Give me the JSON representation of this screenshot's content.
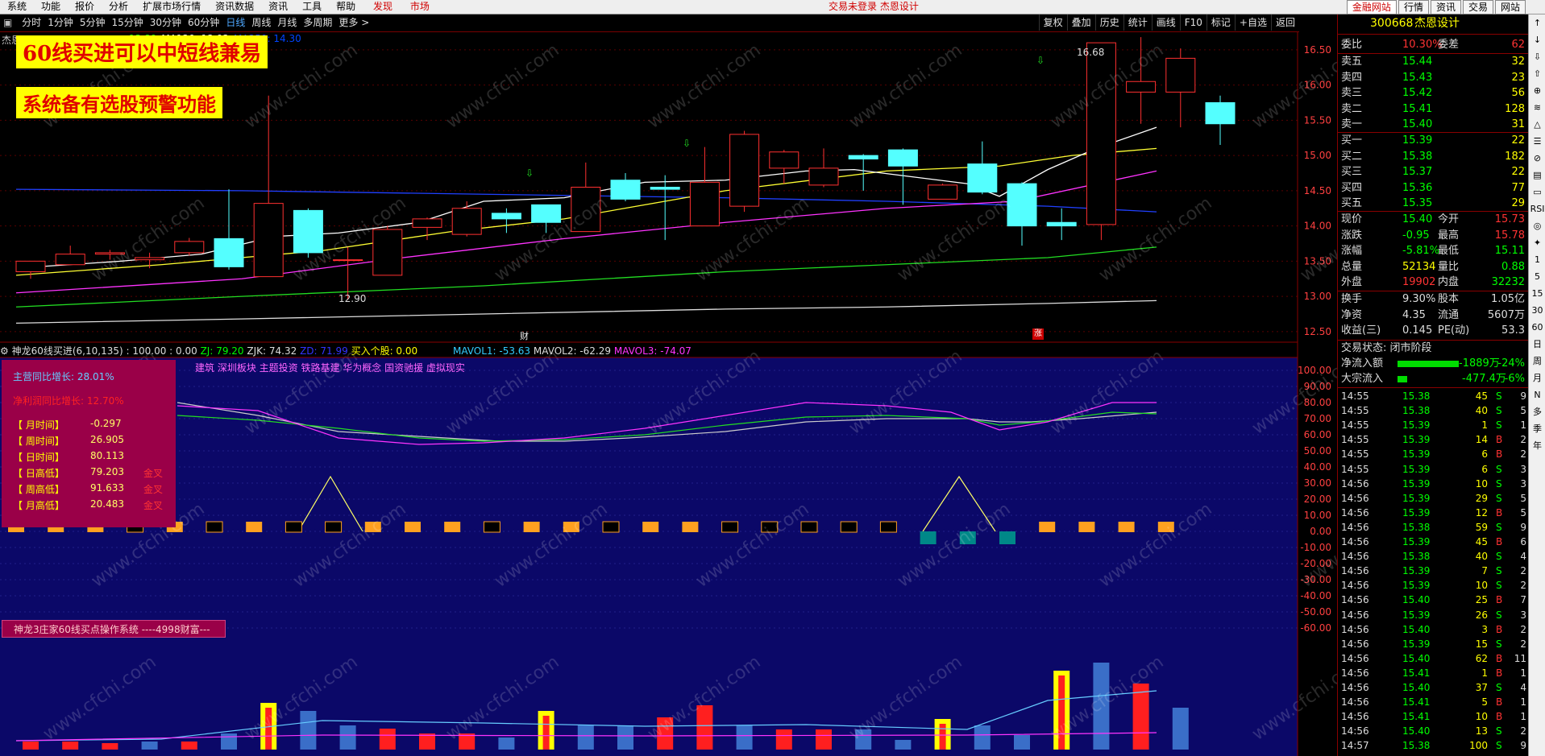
{
  "menu": {
    "items": [
      "系统",
      "功能",
      "报价",
      "分析",
      "扩展市场行情",
      "资讯数据",
      "资讯",
      "工具",
      "帮助"
    ],
    "discover": "发现",
    "market": "市场",
    "center_title": "交易未登录  杰恩设计",
    "right_tabs": [
      "金融网站",
      "行情",
      "资讯",
      "交易",
      "网站"
    ]
  },
  "periods": [
    "分时",
    "1分钟",
    "5分钟",
    "15分钟",
    "30分钟",
    "60分钟",
    "日线",
    "周线",
    "月线",
    "多周期",
    "更多 >"
  ],
  "active_period": "日线",
  "tools": [
    "复权",
    "叠加",
    "历史",
    "统计",
    "画线",
    "F10",
    "标记",
    "+自选",
    "返回"
  ],
  "main_chart": {
    "stock_label": "杰恩",
    "ma_legend": [
      {
        "text": "13.89",
        "color": "#00ff00"
      },
      {
        "text": "MA120: 12.92",
        "color": "#ffffff"
      },
      {
        "text": "MA250: 14.30",
        "color": "#0044ff"
      }
    ],
    "high_label": "16.68",
    "low_label": "12.90",
    "markers": [
      "财",
      "涨"
    ],
    "overlay1": "60线买进可以中短线兼易",
    "overlay2": "系统备有选股预警功能",
    "axis": [
      "16.50",
      "16.00",
      "15.50",
      "15.00",
      "14.50",
      "14.00",
      "13.50",
      "13.00",
      "12.50"
    ]
  },
  "indicator": {
    "title": "神龙60线买进(6,10,135)",
    "values": ": 100.00 : 0.00",
    "zj": "ZJ: 79.20",
    "zjk": "ZJK: 74.32",
    "zd": "ZD: 71.99",
    "buy": "买入个股: 0.00",
    "mavol1": "MAVOL1: -53.63",
    "mavol2": "MAVOL2: -62.29",
    "mavol3": "MAVOL3: -74.07",
    "concepts": "建筑 深圳板块 主题投资 铁路基建 华为概念 国资驰援 虚拟现实",
    "panel": {
      "line1": "主营同比增长: 28.01%",
      "line2": "净利润同比增长: 12.70%",
      "rows": [
        {
          "label": "【 月时间】",
          "value": "-0.297",
          "tag": ""
        },
        {
          "label": "【 周时间】",
          "value": "26.905",
          "tag": ""
        },
        {
          "label": "【 日时间】",
          "value": "80.113",
          "tag": ""
        },
        {
          "label": "【 日高低】",
          "value": "79.203",
          "tag": "金叉"
        },
        {
          "label": "【 周高低】",
          "value": "91.633",
          "tag": "金叉"
        },
        {
          "label": "【 月高低】",
          "value": "20.483",
          "tag": "金叉"
        }
      ]
    },
    "system_label": "神龙3庄家60线买点操作系统 ----4998财富---",
    "axis": [
      "100.00",
      "90.00",
      "80.00",
      "70.00",
      "60.00",
      "50.00",
      "40.00",
      "30.00",
      "20.00",
      "10.00",
      "0.00",
      "-10.00",
      "-20.00",
      "-30.00",
      "-40.00",
      "-50.00",
      "-60.00"
    ]
  },
  "quote": {
    "code": "300668",
    "name": "杰恩设计",
    "weibi_label": "委比",
    "weibi_value": "10.30%",
    "weicha_label": "委差",
    "weicha_value": "62",
    "sells": [
      {
        "label": "卖五",
        "price": "15.44",
        "vol": "32"
      },
      {
        "label": "卖四",
        "price": "15.43",
        "vol": "23"
      },
      {
        "label": "卖三",
        "price": "15.42",
        "vol": "56"
      },
      {
        "label": "卖二",
        "price": "15.41",
        "vol": "128"
      },
      {
        "label": "卖一",
        "price": "15.40",
        "vol": "31"
      }
    ],
    "buys": [
      {
        "label": "买一",
        "price": "15.39",
        "vol": "22"
      },
      {
        "label": "买二",
        "price": "15.38",
        "vol": "182"
      },
      {
        "label": "买三",
        "price": "15.37",
        "vol": "22"
      },
      {
        "label": "买四",
        "price": "15.36",
        "vol": "77"
      },
      {
        "label": "买五",
        "price": "15.35",
        "vol": "29"
      }
    ],
    "stats": [
      {
        "l1": "现价",
        "v1": "15.40",
        "c1": "#00ff00",
        "l2": "今开",
        "v2": "15.73",
        "c2": "#ff3333"
      },
      {
        "l1": "涨跌",
        "v1": "-0.95",
        "c1": "#00ff00",
        "l2": "最高",
        "v2": "15.78",
        "c2": "#ff3333"
      },
      {
        "l1": "涨幅",
        "v1": "-5.81%",
        "c1": "#00ff00",
        "l2": "最低",
        "v2": "15.11",
        "c2": "#00ff00"
      },
      {
        "l1": "总量",
        "v1": "52134",
        "c1": "#ffff00",
        "l2": "量比",
        "v2": "0.88",
        "c2": "#00ff00"
      },
      {
        "l1": "外盘",
        "v1": "19902",
        "c1": "#ff3333",
        "l2": "内盘",
        "v2": "32232",
        "c2": "#00ff00"
      }
    ],
    "stats2": [
      {
        "l1": "换手",
        "v1": "9.30%",
        "l2": "股本",
        "v2": "1.05亿"
      },
      {
        "l1": "净资",
        "v1": "4.35",
        "l2": "流通",
        "v2": "5607万"
      },
      {
        "l1": "收益(三)",
        "v1": "0.145",
        "l2": "PE(动)",
        "v2": "53.3"
      }
    ],
    "trade_status": "交易状态: 闭市阶段",
    "net_inflow_label": "净流入额",
    "net_inflow_value": "-1889万",
    "net_inflow_pct": "-24%",
    "big_inflow_label": "大宗流入",
    "big_inflow_value": "-477.4万",
    "big_inflow_pct": "-6%",
    "ticks": [
      {
        "t": "14:55",
        "p": "15.38",
        "v": "45",
        "d": "S",
        "n": "9"
      },
      {
        "t": "14:55",
        "p": "15.38",
        "v": "40",
        "d": "S",
        "n": "5"
      },
      {
        "t": "14:55",
        "p": "15.39",
        "v": "1",
        "d": "S",
        "n": "1"
      },
      {
        "t": "14:55",
        "p": "15.39",
        "v": "14",
        "d": "B",
        "n": "2"
      },
      {
        "t": "14:55",
        "p": "15.39",
        "v": "6",
        "d": "B",
        "n": "2"
      },
      {
        "t": "14:55",
        "p": "15.39",
        "v": "6",
        "d": "S",
        "n": "3"
      },
      {
        "t": "14:56",
        "p": "15.39",
        "v": "10",
        "d": "S",
        "n": "3"
      },
      {
        "t": "14:56",
        "p": "15.39",
        "v": "29",
        "d": "S",
        "n": "5"
      },
      {
        "t": "14:56",
        "p": "15.39",
        "v": "12",
        "d": "B",
        "n": "5"
      },
      {
        "t": "14:56",
        "p": "15.38",
        "v": "59",
        "d": "S",
        "n": "9"
      },
      {
        "t": "14:56",
        "p": "15.39",
        "v": "45",
        "d": "B",
        "n": "6"
      },
      {
        "t": "14:56",
        "p": "15.38",
        "v": "40",
        "d": "S",
        "n": "4"
      },
      {
        "t": "14:56",
        "p": "15.39",
        "v": "7",
        "d": "S",
        "n": "2"
      },
      {
        "t": "14:56",
        "p": "15.39",
        "v": "10",
        "d": "S",
        "n": "2"
      },
      {
        "t": "14:56",
        "p": "15.40",
        "v": "25",
        "d": "B",
        "n": "7"
      },
      {
        "t": "14:56",
        "p": "15.39",
        "v": "26",
        "d": "S",
        "n": "3"
      },
      {
        "t": "14:56",
        "p": "15.40",
        "v": "3",
        "d": "B",
        "n": "2"
      },
      {
        "t": "14:56",
        "p": "15.39",
        "v": "15",
        "d": "S",
        "n": "2"
      },
      {
        "t": "14:56",
        "p": "15.40",
        "v": "62",
        "d": "B",
        "n": "11"
      },
      {
        "t": "14:56",
        "p": "15.41",
        "v": "1",
        "d": "B",
        "n": "1"
      },
      {
        "t": "14:56",
        "p": "15.40",
        "v": "37",
        "d": "S",
        "n": "4"
      },
      {
        "t": "14:56",
        "p": "15.41",
        "v": "5",
        "d": "B",
        "n": "1"
      },
      {
        "t": "14:56",
        "p": "15.41",
        "v": "10",
        "d": "B",
        "n": "1"
      },
      {
        "t": "14:56",
        "p": "15.40",
        "v": "13",
        "d": "S",
        "n": "2"
      },
      {
        "t": "14:57",
        "p": "15.38",
        "v": "100",
        "d": "S",
        "n": "9"
      }
    ]
  },
  "sidebar_items": [
    "↑",
    "↓",
    "⇩",
    "⇧",
    "⊕",
    "≋",
    "△",
    "☰",
    "⊘",
    "▤",
    "▭",
    "RSI",
    "◎",
    "✦",
    "1",
    "5",
    "15",
    "30",
    "60",
    "日",
    "周",
    "月",
    "N",
    "多",
    "季",
    "年"
  ],
  "watermark": "www.cfchi.com"
}
